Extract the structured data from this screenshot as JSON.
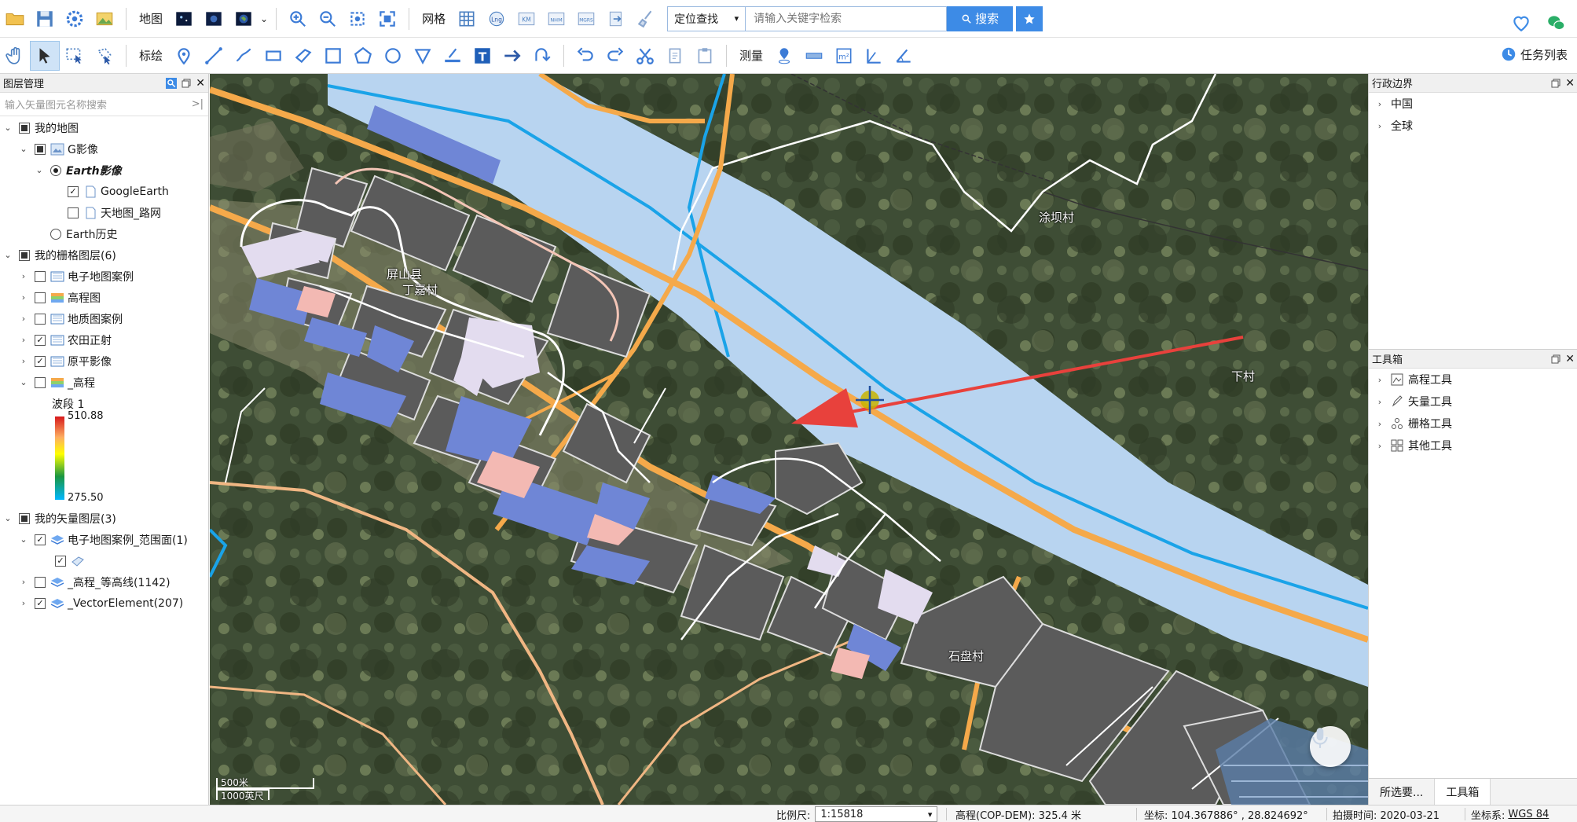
{
  "toolbar1": {
    "map_label": "地图",
    "grid_label": "网格",
    "search_mode": "定位查找",
    "search_placeholder": "请输入关键字检索",
    "search_button": "搜索",
    "grid_icons": [
      "Lng",
      "KM",
      "NHM",
      "MGRS"
    ]
  },
  "toolbar2": {
    "annotate_label": "标绘",
    "measure_label": "测量",
    "tasklist_label": "任务列表",
    "text_icon": "T"
  },
  "layer_panel": {
    "title": "图层管理",
    "search_placeholder": "输入矢量图元名称搜索",
    "nodes": [
      {
        "label": "我的地图"
      },
      {
        "label": "G影像"
      },
      {
        "label": "Earth影像"
      },
      {
        "label": "GoogleEarth"
      },
      {
        "label": "天地图_路网"
      },
      {
        "label": "Earth历史"
      },
      {
        "label": "我的栅格图层(6)"
      },
      {
        "label": "电子地图案例"
      },
      {
        "label": "高程图"
      },
      {
        "label": "地质图案例"
      },
      {
        "label": "农田正射"
      },
      {
        "label": "原平影像"
      },
      {
        "label": "_高程"
      },
      {
        "label": "我的矢量图层(3)"
      },
      {
        "label": "电子地图案例_范围面(1)"
      },
      {
        "label": "_高程_等高线(1142)"
      },
      {
        "label": "_VectorElement(207)"
      }
    ],
    "legend": {
      "band": "波段 1",
      "max": "510.88",
      "min": "275.50"
    }
  },
  "admin_panel": {
    "title": "行政边界",
    "items": [
      "中国",
      "全球"
    ]
  },
  "toolbox_panel": {
    "title": "工具箱",
    "items": [
      "高程工具",
      "矢量工具",
      "栅格工具",
      "其他工具"
    ]
  },
  "right_tabs": [
    "所选要...",
    "工具箱"
  ],
  "map": {
    "labels": {
      "county": "屏山县",
      "village_dingjia": "丁嘉村",
      "village_tuba": "涂坝村",
      "village_xia": "下村",
      "village_shipan": "石盘村"
    },
    "scale_metric": "500米",
    "scale_imperial": "1000英尺"
  },
  "statusbar": {
    "scale_label": "比例尺:",
    "scale_value": "1:15818",
    "elevation": "高程(COP-DEM):  325.4 米",
    "coords": "坐标:  104.367886° , 28.824692°",
    "capture_time": "拍摄时间:  2020-03-21",
    "crs_label": "坐标系:",
    "crs_value": "WGS 84"
  },
  "colors": {
    "accent": "#3d8be6",
    "river": "#b8d4f0",
    "river_line": "#1aa3e8",
    "road": "#f5a94a",
    "block": "#5b5b5b",
    "arrow": "#e8413c"
  }
}
